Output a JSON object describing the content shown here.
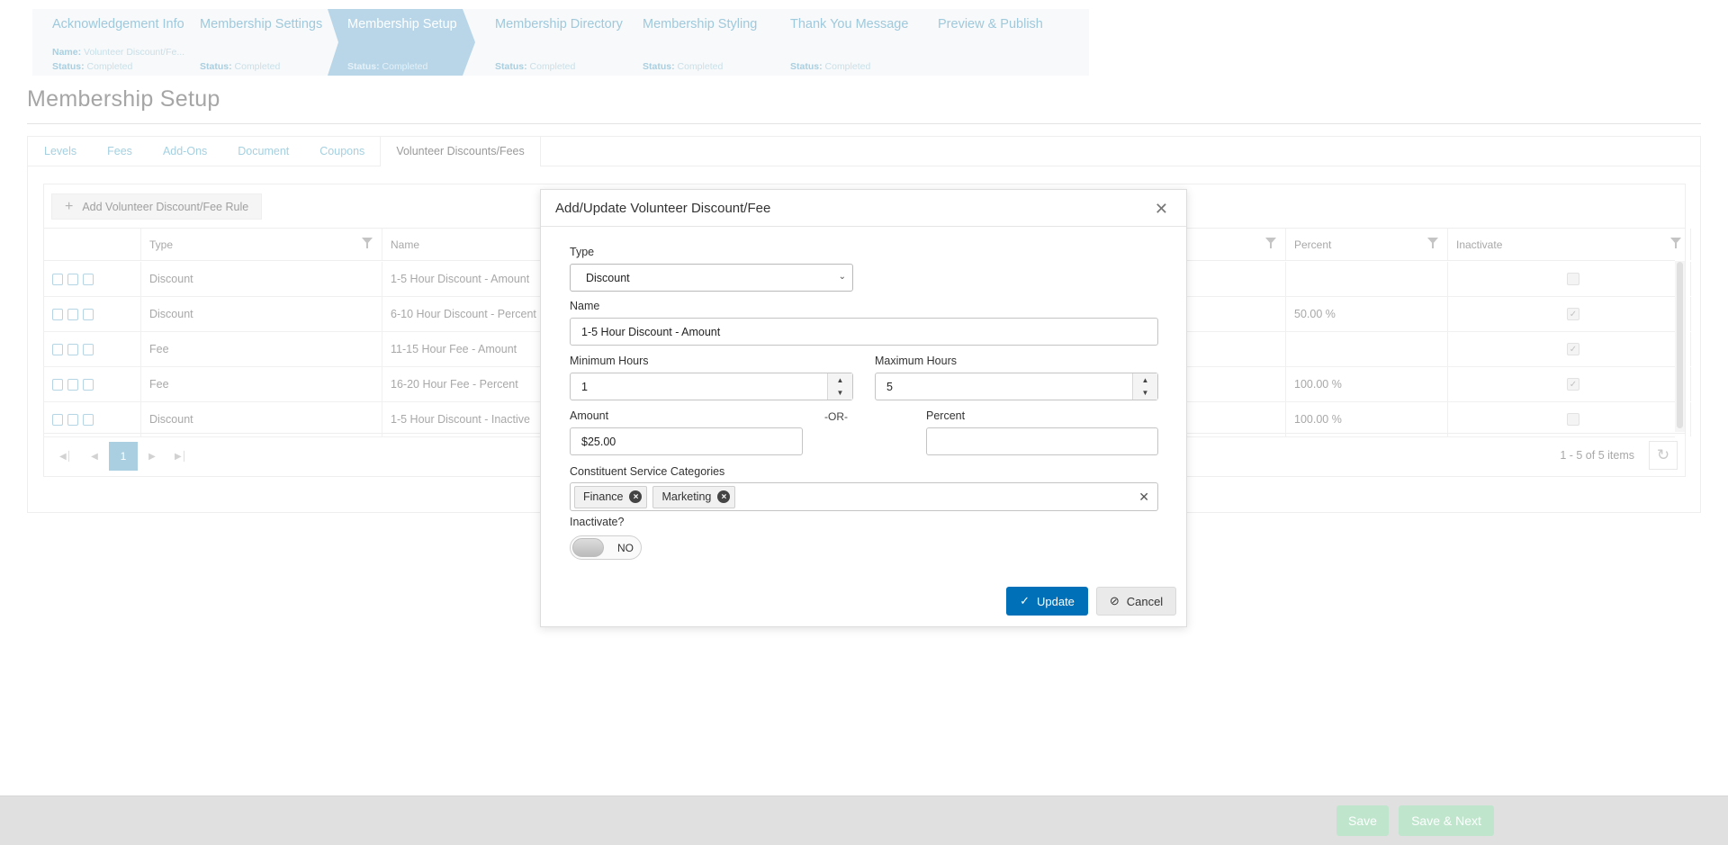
{
  "wizard": {
    "steps": [
      {
        "title": "Acknowledgement Info",
        "name_label": "Name:",
        "name_value": "Volunteer Discount/Fe...",
        "status_label": "Status:",
        "status_value": "Completed"
      },
      {
        "title": "Membership Settings",
        "status_label": "Status:",
        "status_value": "Completed"
      },
      {
        "title": "Membership Setup",
        "status_label": "Status:",
        "status_value": "Completed"
      },
      {
        "title": "Membership Directory",
        "status_label": "Status:",
        "status_value": "Completed"
      },
      {
        "title": "Membership Styling",
        "status_label": "Status:",
        "status_value": "Completed"
      },
      {
        "title": "Thank You Message",
        "status_label": "Status:",
        "status_value": "Completed"
      },
      {
        "title": "Preview & Publish"
      }
    ],
    "active_step": 2
  },
  "page": {
    "title": "Membership Setup"
  },
  "tabs": [
    "Levels",
    "Fees",
    "Add-Ons",
    "Document",
    "Coupons",
    "Volunteer Discounts/Fees"
  ],
  "grid": {
    "add_button": "Add Volunteer Discount/Fee Rule",
    "columns": {
      "type": "Type",
      "name": "Name",
      "percent": "Percent",
      "inactivate": "Inactivate"
    },
    "rows": [
      {
        "type": "Discount",
        "name": "1-5 Hour Discount - Amount",
        "percent": "",
        "inactive": false
      },
      {
        "type": "Discount",
        "name": "6-10 Hour Discount - Percent",
        "percent": "50.00 %",
        "inactive": true
      },
      {
        "type": "Fee",
        "name": "11-15 Hour Fee - Amount",
        "percent": "",
        "inactive": true
      },
      {
        "type": "Fee",
        "name": "16-20 Hour Fee - Percent",
        "percent": "100.00 %",
        "inactive": true
      },
      {
        "type": "Discount",
        "name": "1-5 Hour Discount - Inactive",
        "percent": "100.00 %",
        "inactive": false
      }
    ],
    "pager": {
      "current_page": "1",
      "info": "1 - 5 of 5 items"
    }
  },
  "modal": {
    "title": "Add/Update Volunteer Discount/Fee",
    "type_label": "Type",
    "type_value": "Discount",
    "name_label": "Name",
    "name_value": "1-5 Hour Discount - Amount",
    "min_hours_label": "Minimum Hours",
    "min_hours_value": "1",
    "max_hours_label": "Maximum Hours",
    "max_hours_value": "5",
    "amount_label": "Amount",
    "amount_value": "$25.00",
    "or_text": "-OR-",
    "percent_label": "Percent",
    "percent_value": "",
    "categories_label": "Constituent Service Categories",
    "categories": [
      "Finance",
      "Marketing"
    ],
    "inactivate_label": "Inactivate?",
    "inactivate_value": "NO",
    "update_button": "Update",
    "cancel_button": "Cancel"
  },
  "footer": {
    "save": "Save",
    "save_next": "Save & Next"
  },
  "colors": {
    "primary": "#0071b8",
    "wizard_active": "#b8d6e8",
    "save_disabled": "#bfe5cc"
  }
}
